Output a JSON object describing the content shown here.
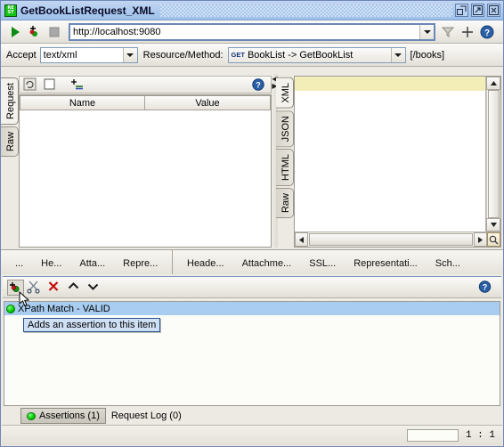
{
  "window": {
    "title": "GetBookListRequest_XML",
    "icon": "rest-icon",
    "icon_text_top": "RE",
    "icon_text_bottom": "ST",
    "controls": [
      {
        "name": "restore-button",
        "glyph": "restore-icon"
      },
      {
        "name": "maximize-button",
        "glyph": "maximize-icon"
      },
      {
        "name": "close-button",
        "glyph": "close-icon"
      }
    ]
  },
  "toolbar": {
    "run_icon": "play-icon",
    "run_add_icon": "run-add-endpoint-icon",
    "stop_icon": "stop-icon",
    "url": "http://localhost:9080",
    "url_placeholder": "http://localhost:9080",
    "filter_icon": "filter-icon",
    "add_icon": "plus-icon",
    "help_icon": "help-icon"
  },
  "optionsbar": {
    "accept_label": "Accept",
    "accept_value": "text/xml",
    "resource_label": "Resource/Method:",
    "method_badge": "GET",
    "resource_value": "BookList -> GetBookList",
    "path": "[/books]"
  },
  "request_panel": {
    "tabs": [
      {
        "label": "Request",
        "selected": true
      },
      {
        "label": "Raw",
        "selected": false
      }
    ],
    "tools": [
      {
        "name": "refresh-params-icon"
      },
      {
        "name": "checkbox-icon"
      },
      {
        "name": "add-param-icon"
      },
      {
        "name": "help-icon"
      }
    ],
    "columns": [
      "Name",
      "Value"
    ],
    "rows": []
  },
  "response_panel": {
    "tabs": [
      {
        "label": "XML",
        "selected": true
      },
      {
        "label": "JSON",
        "selected": false
      },
      {
        "label": "HTML",
        "selected": false
      },
      {
        "label": "Raw",
        "selected": false
      }
    ],
    "content": "",
    "scroll_corner_icon": "zoom-icon"
  },
  "subtabs": {
    "left": [
      "...",
      "He...",
      "Atta...",
      "Repre..."
    ],
    "right": [
      "Heade...",
      "Attachme...",
      "SSL...",
      "Representati...",
      "Sch..."
    ]
  },
  "assertions": {
    "tools": [
      {
        "name": "add-assertion-button",
        "glyph": "add-assertion-icon",
        "pressed": true
      },
      {
        "name": "configure-assertion-button",
        "glyph": "scissors-icon",
        "pressed": false
      },
      {
        "name": "remove-assertion-button",
        "glyph": "delete-x-icon",
        "pressed": false
      },
      {
        "name": "move-up-button",
        "glyph": "chevron-up-icon",
        "pressed": false
      },
      {
        "name": "move-down-button",
        "glyph": "chevron-down-icon",
        "pressed": false
      },
      {
        "name": "assertions-help-button",
        "glyph": "help-icon",
        "pressed": false
      }
    ],
    "items": [
      {
        "label": "XPath Match - VALID",
        "status": "valid",
        "selected": true
      }
    ],
    "tooltip": "Adds an assertion to this item"
  },
  "bottom_tabs": [
    {
      "label": "Assertions (1)",
      "selected": true,
      "status": "valid"
    },
    {
      "label": "Request Log (0)",
      "selected": false,
      "status": "none"
    }
  ],
  "statusbar": {
    "field_value": "",
    "position": "1 : 1"
  },
  "colors": {
    "title_bar": "#aecbee",
    "selection": "#a8cdf0",
    "highlight_line": "#f3eeb8",
    "valid_green": "#00c800",
    "delete_red": "#cc0000",
    "window_border": "#6d87b5"
  }
}
